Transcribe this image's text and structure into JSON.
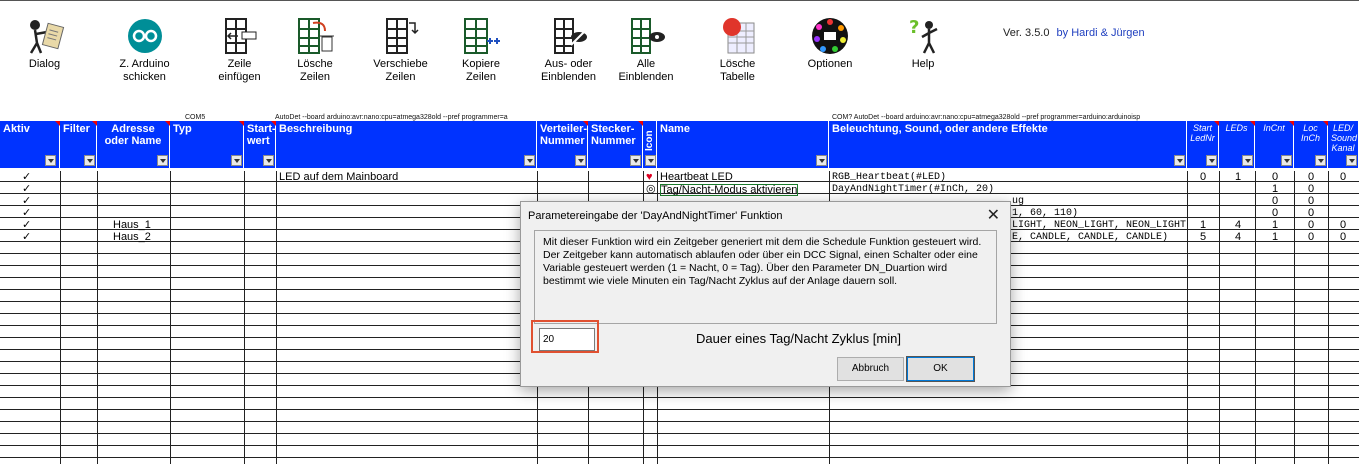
{
  "ribbon": {
    "buttons": [
      {
        "label": "Dialog",
        "icon": "dialog-figure-icon"
      },
      {
        "label": "Z. Arduino schicken",
        "icon": "arduino-icon"
      },
      {
        "label": "Zeile einfügen",
        "icon": "insert-row-icon"
      },
      {
        "label": "Lösche Zeilen",
        "icon": "delete-rows-icon"
      },
      {
        "label": "Verschiebe Zeilen",
        "icon": "move-rows-icon"
      },
      {
        "label": "Kopiere Zeilen",
        "icon": "copy-rows-icon"
      },
      {
        "label": "Aus- oder Einblenden",
        "icon": "hide-show-icon"
      },
      {
        "label": "Alle Einblenden",
        "icon": "show-all-icon"
      },
      {
        "label": "Lösche Tabelle",
        "icon": "new-table-icon"
      },
      {
        "label": "Optionen",
        "icon": "options-wheel-icon"
      },
      {
        "label": "Help",
        "icon": "help-figure-icon"
      }
    ],
    "version": "Ver. 3.5.0",
    "authors": "by Hardi & Jürgen",
    "status_com5": "COM5",
    "status_left": "AutoDet --board arduino:avr:nano:cpu=atmega328old --pref programmer=a",
    "status_right": "COM? AutoDet --board arduino:avr:nano:cpu=atmega328old --pref programmer=arduino:arduinoisp"
  },
  "table": {
    "headers": {
      "aktiv": "Aktiv",
      "filter": "Filter",
      "adresse": "Adresse oder Name",
      "typ": "Typ",
      "startwert": "Start- wert",
      "beschreibung": "Beschreibung",
      "verteiler": "Verteiler- Nummer",
      "stecker": "Stecker- Nummer",
      "icon": "Icon",
      "name": "Name",
      "beleuchtung": "Beleuchtung, Sound, oder andere Effekte",
      "startled": "Start LedNr",
      "leds": "LEDs",
      "incnt": "InCnt",
      "locinch": "Loc InCh",
      "ledsound": "LED/ Sound Kanal"
    },
    "rows": [
      {
        "aktiv": "✓",
        "adresse": "",
        "beschreibung": "LED auf dem Mainboard",
        "icon": "heart",
        "name": "Heartbeat LED",
        "effekt": "RGB_Heartbeat(#LED)",
        "startled": "0",
        "leds": "1",
        "incnt": "0",
        "locinch": "0",
        "ledsound": "0"
      },
      {
        "aktiv": "✓",
        "adresse": "",
        "beschreibung": "",
        "icon": "clock",
        "name": "Tag/Nacht-Modus aktivieren",
        "effekt": "DayAndNightTimer(#InCh, 20)",
        "startled": "",
        "leds": "",
        "incnt": "1",
        "locinch": "0",
        "ledsound": ""
      },
      {
        "aktiv": "✓",
        "adresse": "",
        "beschreibung": "",
        "icon": "",
        "name": "",
        "effekt": "ug",
        "startled": "",
        "leds": "",
        "incnt": "0",
        "locinch": "0",
        "ledsound": ""
      },
      {
        "aktiv": "✓",
        "adresse": "",
        "beschreibung": "",
        "icon": "",
        "name": "",
        "effekt": "1, 60, 110)",
        "startled": "",
        "leds": "",
        "incnt": "0",
        "locinch": "0",
        "ledsound": ""
      },
      {
        "aktiv": "✓",
        "adresse": "Haus_1",
        "beschreibung": "",
        "icon": "",
        "name": "",
        "effekt": "LIGHT, NEON_LIGHT, NEON_LIGHT, N",
        "startled": "1",
        "leds": "4",
        "incnt": "1",
        "locinch": "0",
        "ledsound": "0"
      },
      {
        "aktiv": "✓",
        "adresse": "Haus_2",
        "beschreibung": "",
        "icon": "",
        "name": "",
        "effekt": "E, CANDLE, CANDLE, CANDLE)",
        "startled": "5",
        "leds": "4",
        "incnt": "1",
        "locinch": "0",
        "ledsound": "0"
      }
    ]
  },
  "dialog": {
    "title": "Parametereingabe der 'DayAndNightTimer' Funktion",
    "description": "Mit dieser Funktion wird ein Zeitgeber generiert mit dem die Schedule Funktion gesteuert wird. Der Zeitgeber kann automatisch ablaufen oder über ein DCC Signal, einen Schalter oder eine Variable gesteuert werden (1 = Nacht, 0 = Tag). Über den Parameter DN_Duartion wird bestimmt wie viele Minuten ein Tag/Nacht Zyklus auf der Anlage dauern soll.",
    "input_value": "20",
    "input_label": "Dauer eines Tag/Nacht Zyklus [min]",
    "cancel_label": "Abbruch",
    "ok_label": "OK"
  },
  "colors": {
    "header_blue": "#0033ff",
    "highlight": "#e05030",
    "version_blue": "#1f3fbf"
  }
}
